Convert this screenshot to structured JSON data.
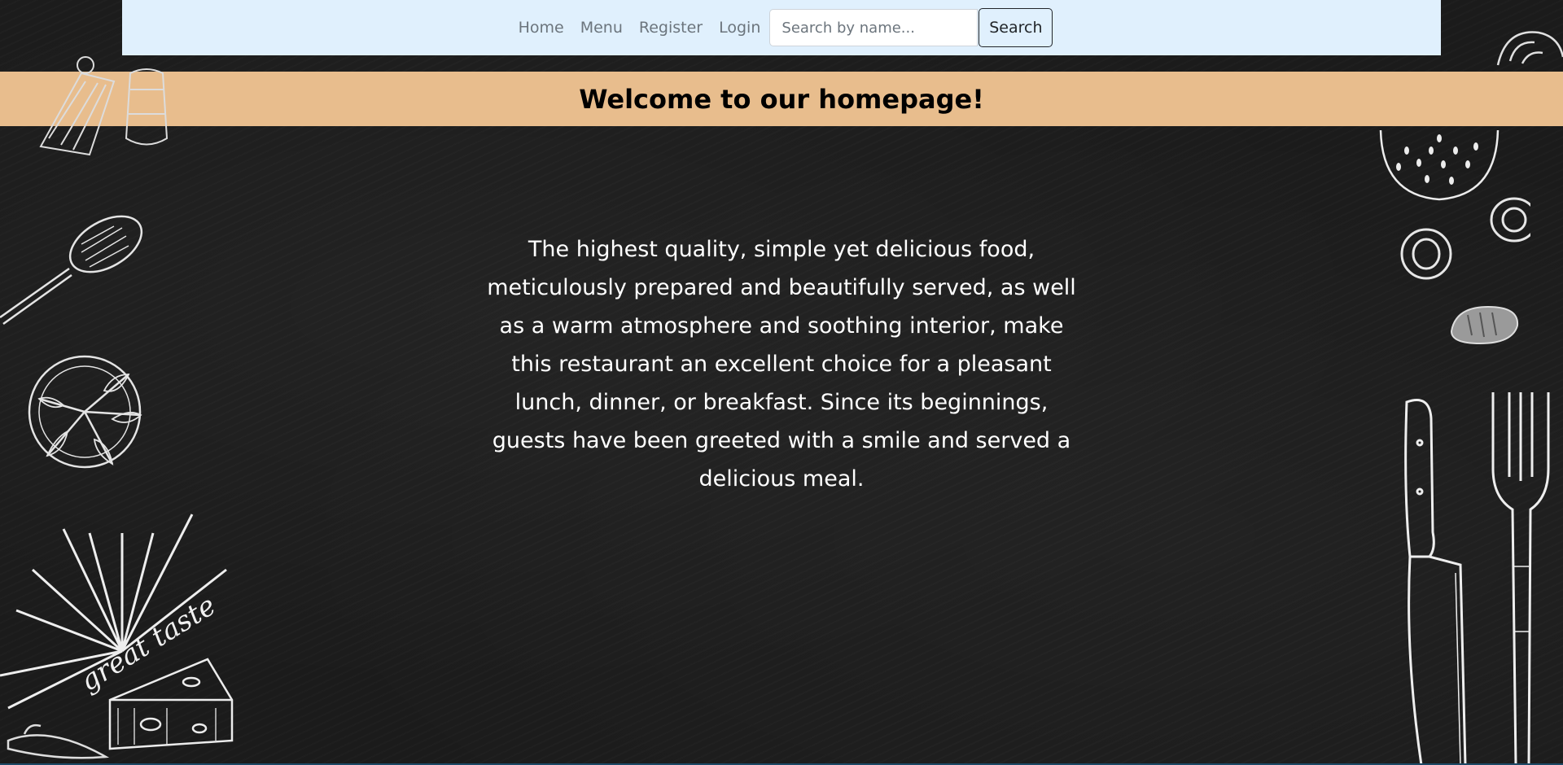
{
  "nav": {
    "links": [
      "Home",
      "Menu",
      "Register",
      "Login"
    ],
    "search_placeholder": "Search by name...",
    "search_value": "",
    "search_button": "Search"
  },
  "banner": {
    "title": "Welcome to our homepage!"
  },
  "intro": {
    "text": "The highest quality, simple yet delicious food, meticulously prepared and beautifully served, as well as a warm atmosphere and soothing interior, make this restaurant an excellent choice for a pleasant lunch, dinner, or breakfast. Since its beginnings, guests have been greeted with a smile and served a delicious meal."
  },
  "decoration": {
    "tagline": "great taste",
    "icons": [
      "wrap-icon",
      "spoon-icon",
      "herb-plate-icon",
      "sunburst-icon",
      "cheese-icon",
      "pepper-icon",
      "pastry-icon",
      "pizza-icon",
      "onion-ring-icon",
      "bread-icon",
      "knife-icon",
      "fork-icon"
    ]
  },
  "colors": {
    "navbar_bg": "#e0f0fd",
    "banner_bg": "#e8bd8d",
    "page_bg": "#1b1b1b",
    "text_light": "#ffffff",
    "nav_link": "#6c757d"
  }
}
